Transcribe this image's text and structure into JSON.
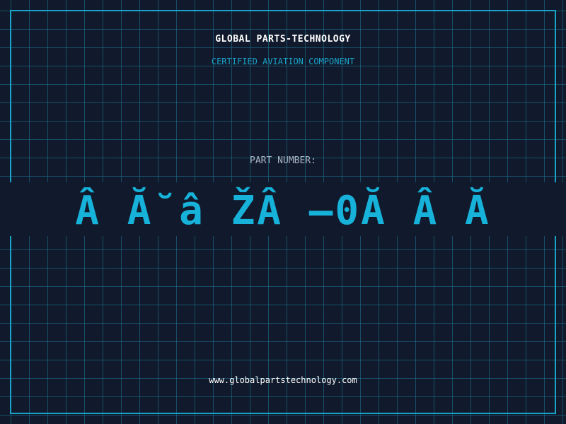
{
  "card": {
    "company": "GLOBAL PARTS-TECHNOLOGY",
    "subtitle": "CERTIFIED AVIATION COMPONENT",
    "part_number_label": "PART NUMBER:",
    "part_number_value": "Â Ă˘â ŽÂ –0Ă Â Ă",
    "website": "www.globalpartstechnology.com"
  },
  "colors": {
    "background": "#111a2c",
    "grid": "#1c7896",
    "accent": "#1aa3c9",
    "label": "#a7b3c2",
    "text": "#ffffff"
  }
}
